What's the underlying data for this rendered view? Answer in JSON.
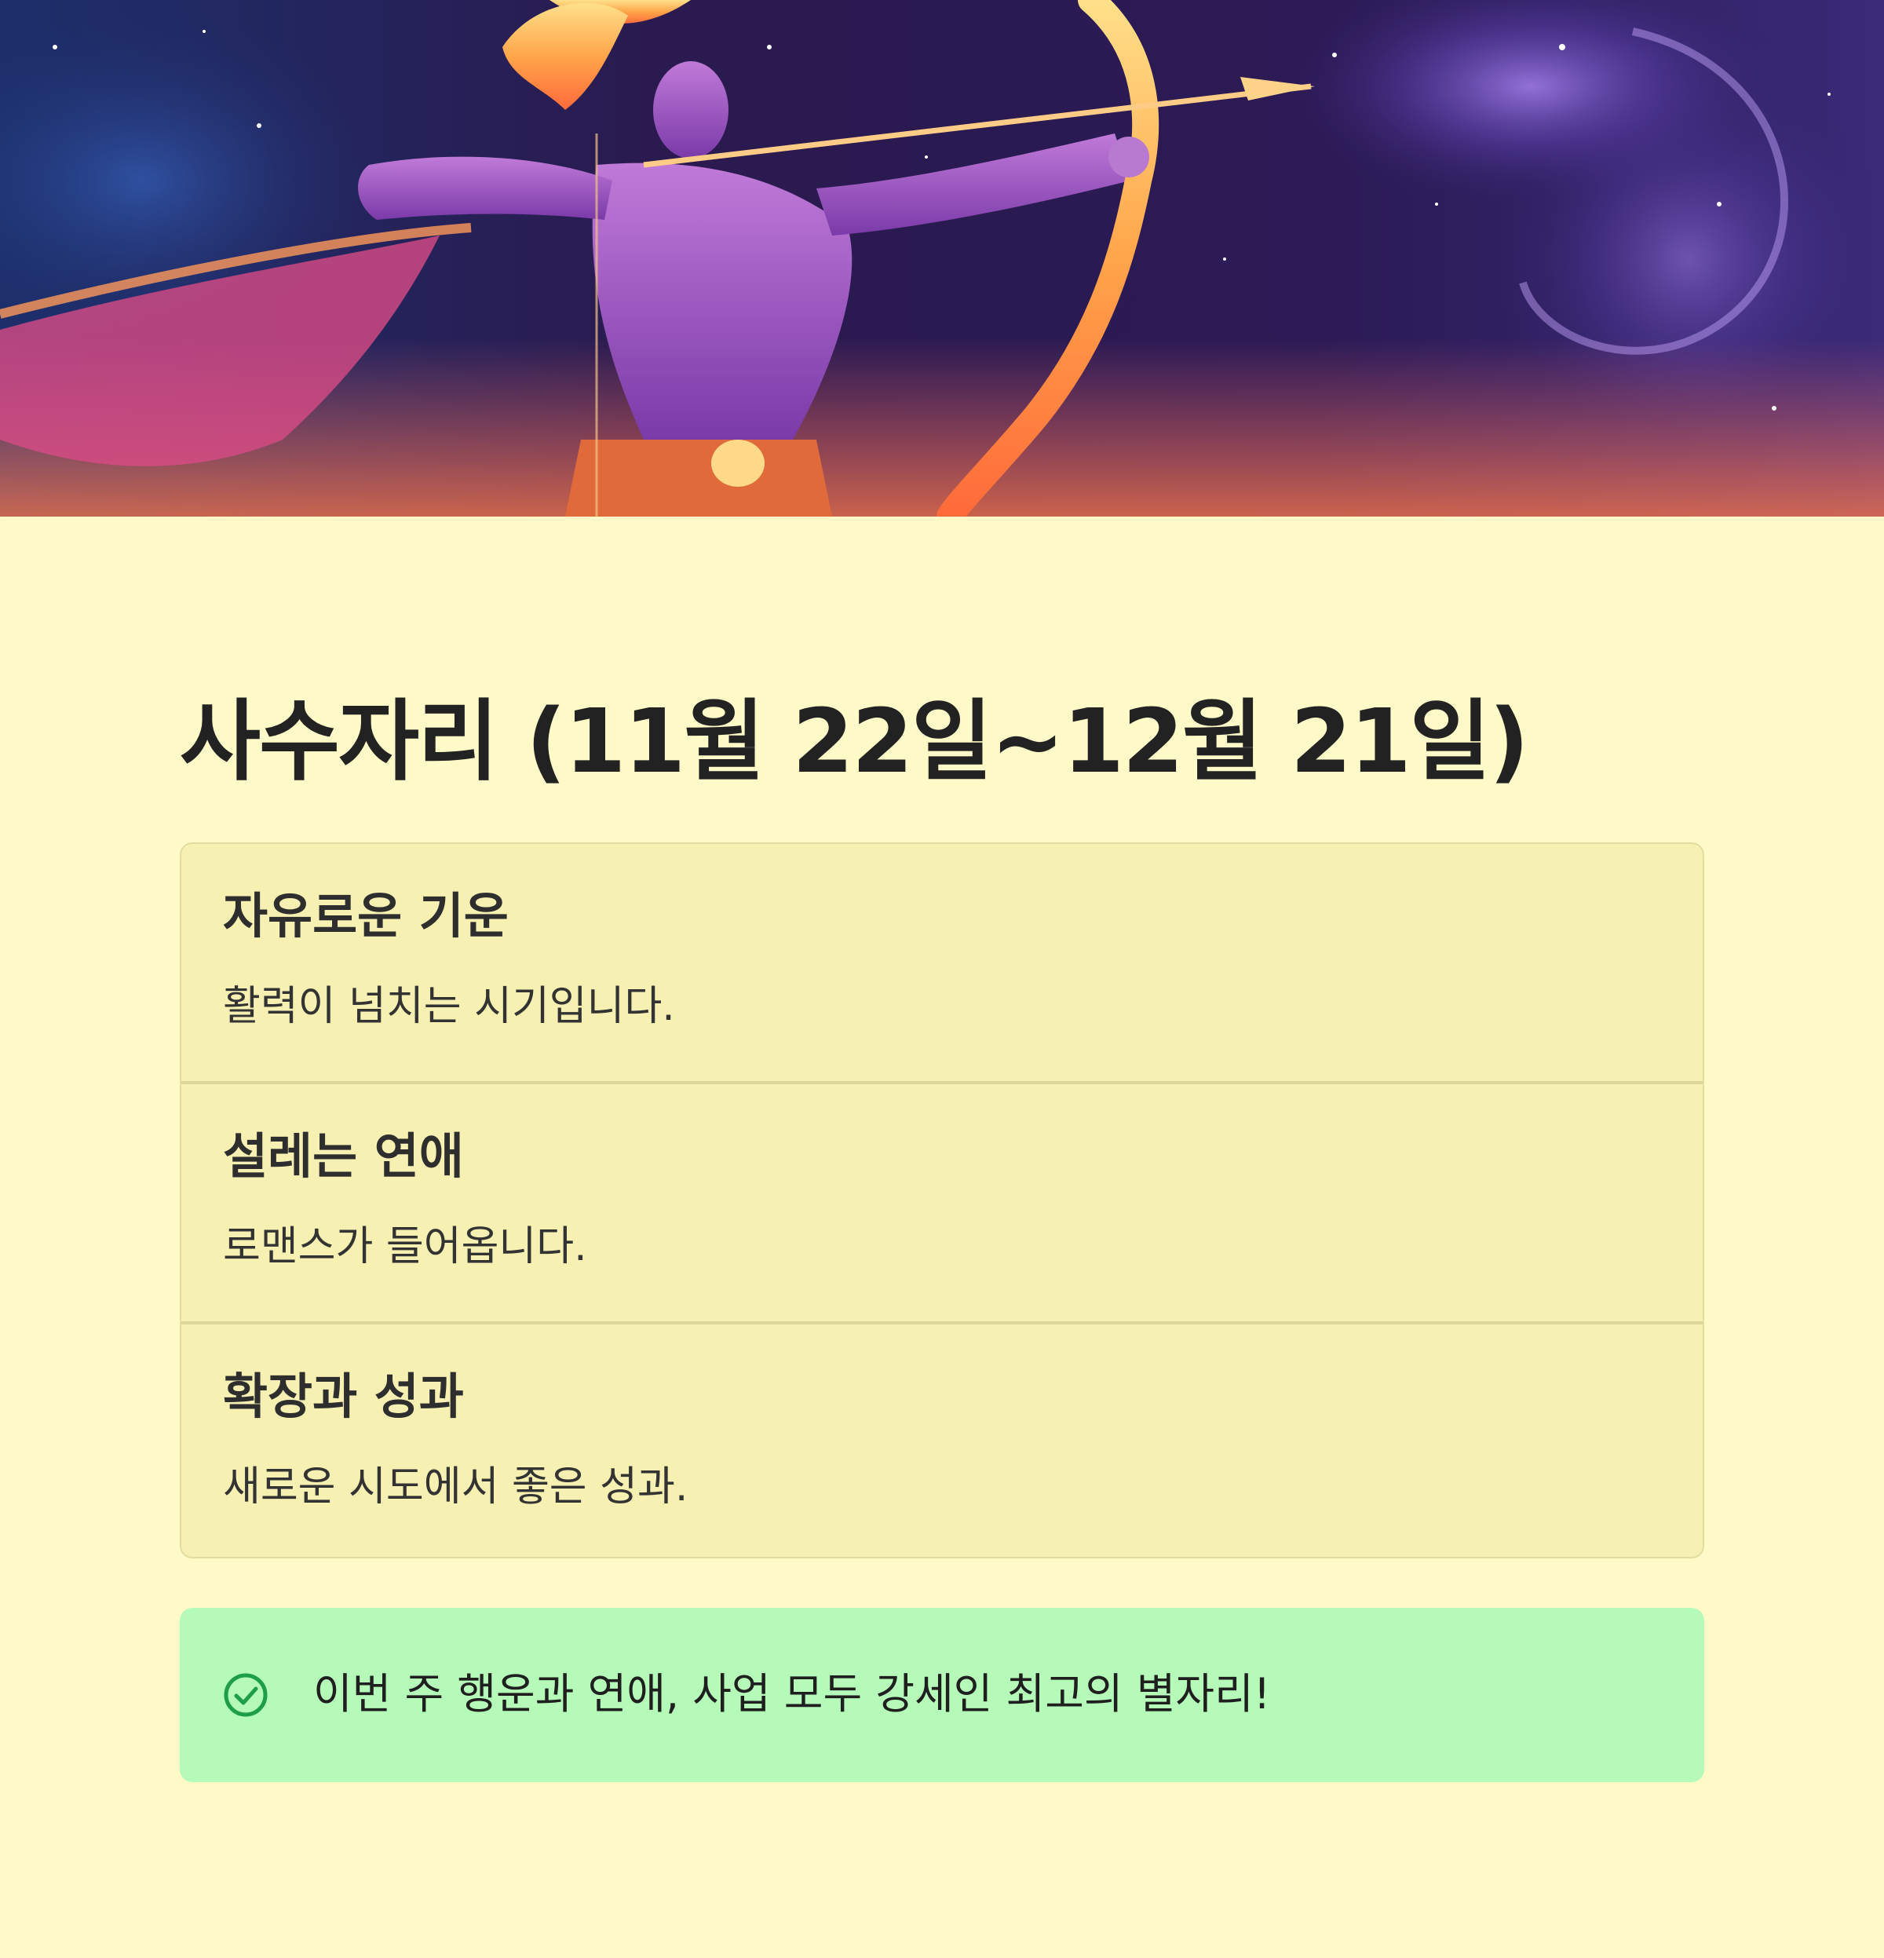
{
  "page": {
    "title": "사수자리 (11월 22일~12월 21일)"
  },
  "card": {
    "sections": [
      {
        "title": "자유로운 기운",
        "text": "활력이 넘치는 시기입니다."
      },
      {
        "title": "설레는 연애",
        "text": "로맨스가 들어옵니다."
      },
      {
        "title": "확장과 성과",
        "text": "새로운 시도에서 좋은 성과."
      }
    ]
  },
  "callout": {
    "icon": "check-circle-icon",
    "text": "이번 주 행운과 연애, 사업 모두 강세인 최고의 별자리!",
    "color": "#1e9e46"
  },
  "colors": {
    "background": "#fffac8",
    "card": "#f6f0b2",
    "callout": "#b5fab8"
  }
}
